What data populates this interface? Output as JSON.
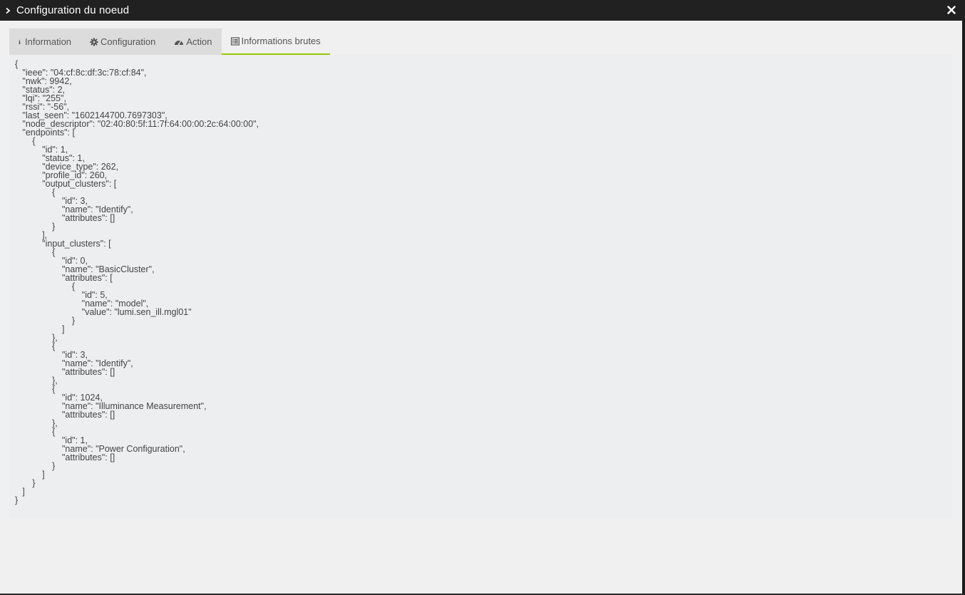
{
  "window": {
    "title": "Configuration du noeud"
  },
  "icons": {
    "title_chevron": "chevron-right-icon",
    "close": "close-icon",
    "tab_information": "info-icon",
    "tab_configuration": "gear-icon",
    "tab_action": "dashboard-icon",
    "tab_raw": "list-icon"
  },
  "tabs": [
    {
      "label": "Information",
      "active": false
    },
    {
      "label": "Configuration",
      "active": false
    },
    {
      "label": "Action",
      "active": false
    },
    {
      "label": "Informations brutes",
      "active": true
    }
  ],
  "colors": {
    "titlebar": "#212121",
    "active_tab_underline": "#94ca02",
    "panel": "#edeeef"
  },
  "raw_json": "{\n   \"ieee\": \"04:cf:8c:df:3c:78:cf:84\",\n   \"nwk\": 9942,\n   \"status\": 2,\n   \"lqi\": \"255\",\n   \"rssi\": \"-56\",\n   \"last_seen\": \"1602144700.7697303\",\n   \"node_descriptor\": \"02:40:80:5f:11:7f:64:00:00:2c:64:00:00\",\n   \"endpoints\": [\n       {\n           \"id\": 1,\n           \"status\": 1,\n           \"device_type\": 262,\n           \"profile_id\": 260,\n           \"output_clusters\": [\n               {\n                   \"id\": 3,\n                   \"name\": \"Identify\",\n                   \"attributes\": []\n               }\n           ],\n           \"input_clusters\": [\n               {\n                   \"id\": 0,\n                   \"name\": \"BasicCluster\",\n                   \"attributes\": [\n                       {\n                           \"id\": 5,\n                           \"name\": \"model\",\n                           \"value\": \"lumi.sen_ill.mgl01\"\n                       }\n                   ]\n               },\n               {\n                   \"id\": 3,\n                   \"name\": \"Identify\",\n                   \"attributes\": []\n               },\n               {\n                   \"id\": 1024,\n                   \"name\": \"Illuminance Measurement\",\n                   \"attributes\": []\n               },\n               {\n                   \"id\": 1,\n                   \"name\": \"Power Configuration\",\n                   \"attributes\": []\n               }\n           ]\n       }\n   ]\n}"
}
